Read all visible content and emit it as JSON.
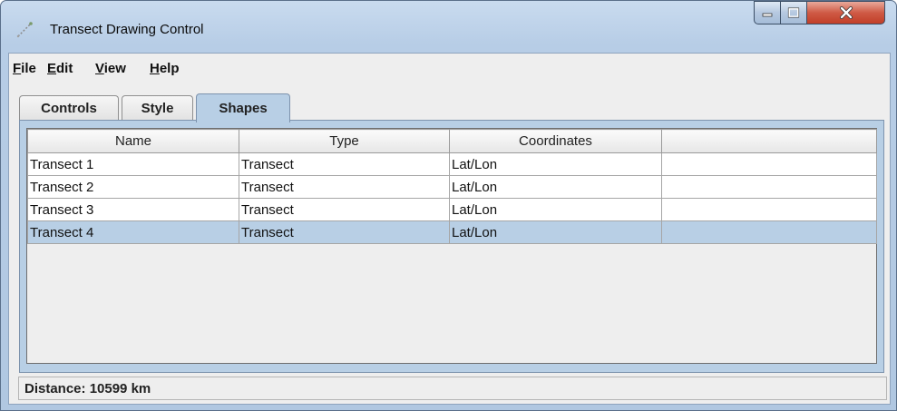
{
  "window": {
    "title": "Transect Drawing Control",
    "icon": "transect-line-icon",
    "controls": [
      "minimize-icon",
      "maximize-icon",
      "close-icon"
    ]
  },
  "menubar": {
    "items": [
      {
        "mnemonic": "F",
        "rest": "ile"
      },
      {
        "mnemonic": "E",
        "rest": "dit"
      },
      {
        "mnemonic": "V",
        "rest": "iew"
      },
      {
        "mnemonic": "H",
        "rest": "elp"
      }
    ]
  },
  "tabs": [
    {
      "label": "Controls",
      "active": false
    },
    {
      "label": "Style",
      "active": false
    },
    {
      "label": "Shapes",
      "active": true
    }
  ],
  "table": {
    "columns": [
      "Name",
      "Type",
      "Coordinates",
      ""
    ],
    "rows": [
      {
        "name": "Transect 1",
        "type": "Transect",
        "coords": "Lat/Lon",
        "extra": "",
        "selected": false
      },
      {
        "name": "Transect 2",
        "type": "Transect",
        "coords": "Lat/Lon",
        "extra": "",
        "selected": false
      },
      {
        "name": "Transect 3",
        "type": "Transect",
        "coords": "Lat/Lon",
        "extra": "",
        "selected": false
      },
      {
        "name": "Transect 4",
        "type": "Transect",
        "coords": "Lat/Lon",
        "extra": "",
        "selected": true
      }
    ]
  },
  "status": {
    "text": "Distance: 10599 km"
  },
  "colors": {
    "selection": "#b8cfe5",
    "close_button": "#c13e28"
  }
}
